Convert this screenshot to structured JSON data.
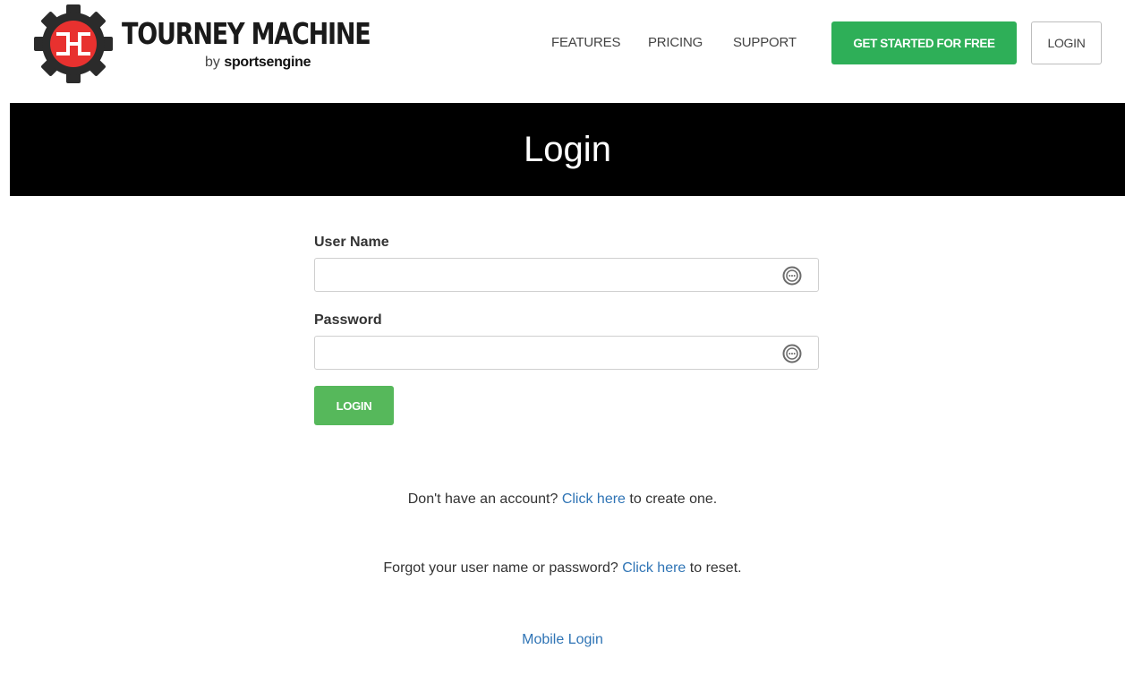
{
  "brand": {
    "title": "TOURNEY MACHINE",
    "by": "by",
    "sub_brand_a": "sport",
    "sub_brand_b": "sengine"
  },
  "nav": {
    "features": "FEATURES",
    "pricing": "PRICING",
    "support": "SUPPORT",
    "cta": "GET STARTED FOR FREE",
    "login": "LOGIN"
  },
  "banner": {
    "title": "Login"
  },
  "form": {
    "username_label": "User Name",
    "username_value": "",
    "password_label": "Password",
    "password_value": "",
    "field_icon": "password-manager-icon",
    "submit": "LOGIN"
  },
  "signup": {
    "prefix": "Don't have an account?",
    "link": "Click here",
    "suffix": "to create one."
  },
  "reset": {
    "prefix": "Forgot your user name or password?",
    "link": "Click here",
    "suffix": "to reset."
  },
  "mobile_login": "Mobile Login",
  "colors": {
    "cta_green": "#2eaf58",
    "submit_green": "#56b85b",
    "logo_red": "#e8312f",
    "link_blue": "#2f74b5",
    "banner_black": "#000000"
  }
}
